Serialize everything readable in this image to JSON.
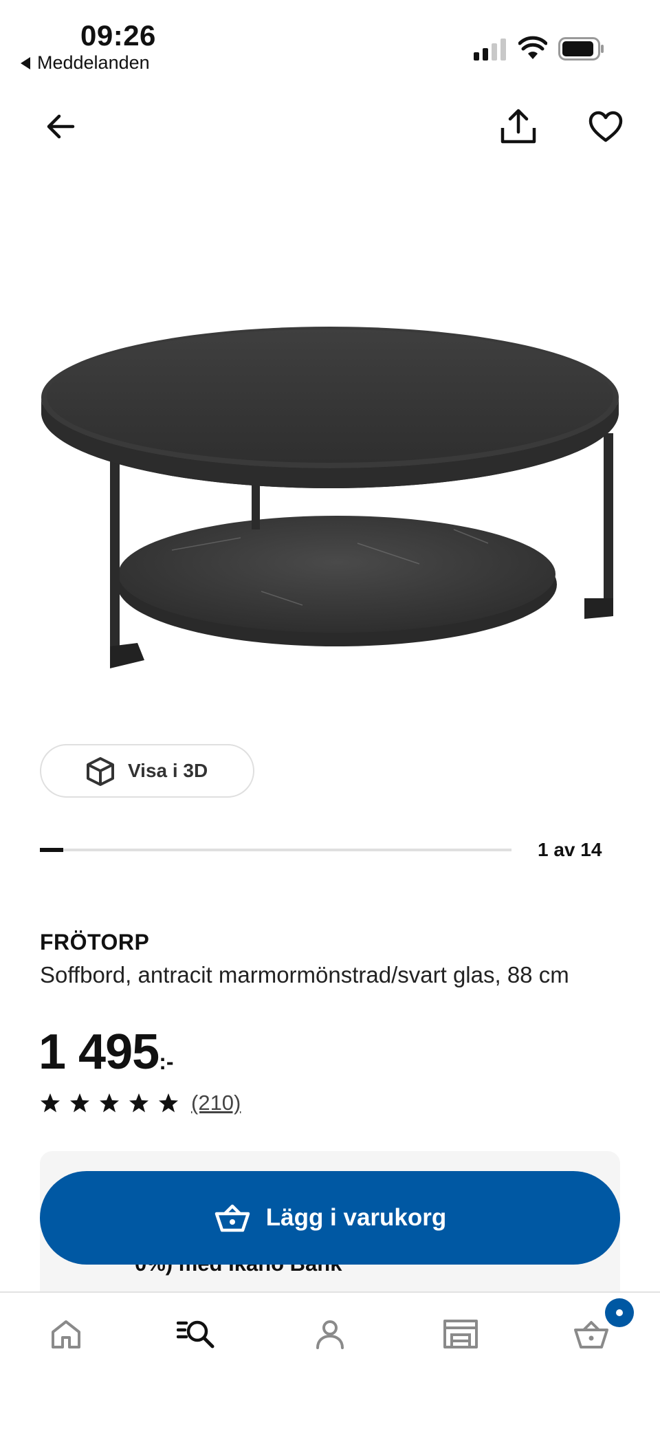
{
  "status_bar": {
    "time": "09:26",
    "back_app": "Meddelanden",
    "icons": [
      "signal-icon",
      "wifi-icon",
      "battery-icon"
    ]
  },
  "top_nav": {
    "icons": [
      "arrow-left-icon",
      "share-icon",
      "heart-icon"
    ]
  },
  "gallery": {
    "view_3d_label": "Visa i 3D",
    "counter": "1 av 14",
    "current_index": 1,
    "total": 14
  },
  "product": {
    "name": "FRÖTORP",
    "description": "Soffbord, antracit marmormönstrad/svart glas, 88 cm",
    "price": "1 495",
    "price_suffix": ":-",
    "rating_stars": 5,
    "review_count": "(210)",
    "partial_text": "0%) med Ikano Bank"
  },
  "cta": {
    "add_to_cart_label": "Lägg i varukorg"
  },
  "bottom_nav": {
    "items": [
      "home-icon",
      "search-icon",
      "profile-icon",
      "store-icon",
      "cart-icon"
    ]
  },
  "colors": {
    "brand_blue": "#0058a3",
    "text": "#111111",
    "panel": "#f5f5f5"
  }
}
